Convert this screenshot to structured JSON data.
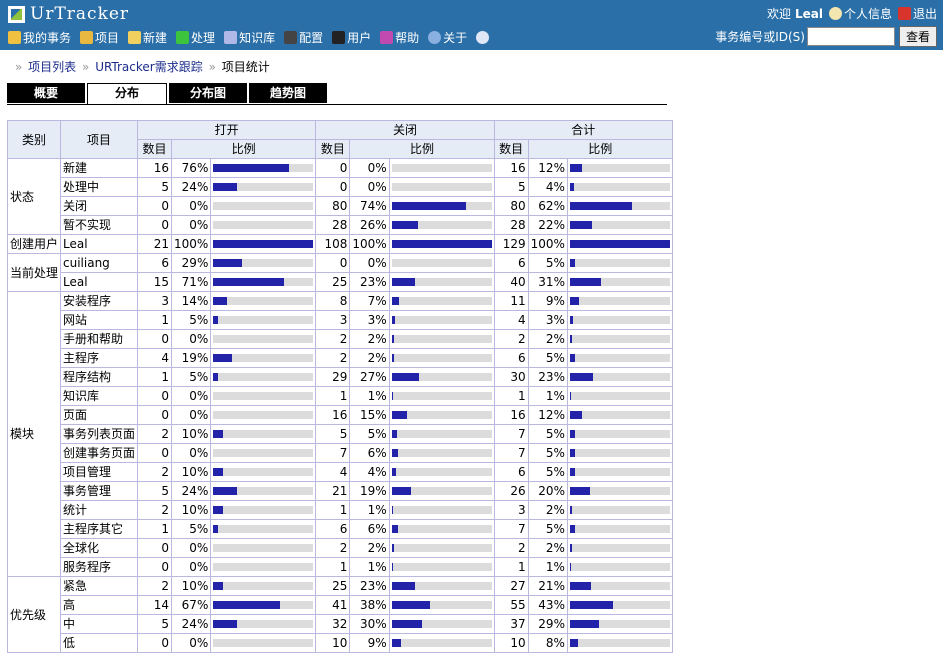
{
  "app": {
    "title": "UrTracker"
  },
  "user": {
    "welcome": "欢迎",
    "name": "Leal",
    "profile": "个人信息",
    "logout": "退出"
  },
  "nav": [
    {
      "label": "我的事务",
      "icon": "home-icon"
    },
    {
      "label": "项目",
      "icon": "project-icon"
    },
    {
      "label": "新建",
      "icon": "new-icon"
    },
    {
      "label": "处理",
      "icon": "check-icon"
    },
    {
      "label": "知识库",
      "icon": "book-icon"
    },
    {
      "label": "配置",
      "icon": "config-icon"
    },
    {
      "label": "用户",
      "icon": "users-icon"
    },
    {
      "label": "帮助",
      "icon": "help-icon"
    },
    {
      "label": "关于",
      "icon": "about-icon"
    },
    {
      "label": "",
      "icon": "info-icon"
    }
  ],
  "search": {
    "label": "事务编号或ID(S)",
    "value": "",
    "button": "查看"
  },
  "breadcrumb": [
    "项目列表",
    "URTracker需求跟踪",
    "项目统计"
  ],
  "tabs": [
    {
      "label": "概要",
      "active": false
    },
    {
      "label": "分布",
      "active": true
    },
    {
      "label": "分布图",
      "active": false
    },
    {
      "label": "趋势图",
      "active": false
    }
  ],
  "table": {
    "headers": {
      "category": "类别",
      "item": "项目",
      "open": "打开",
      "closed": "关闭",
      "total": "合计",
      "count": "数目",
      "ratio": "比例"
    },
    "groups": [
      {
        "category": "状态",
        "rows": [
          {
            "item": "新建",
            "o": 16,
            "op": "76%",
            "c": 0,
            "cp": "0%",
            "t": 16,
            "tp": "12%"
          },
          {
            "item": "处理中",
            "o": 5,
            "op": "24%",
            "c": 0,
            "cp": "0%",
            "t": 5,
            "tp": "4%"
          },
          {
            "item": "关闭",
            "o": 0,
            "op": "0%",
            "c": 80,
            "cp": "74%",
            "t": 80,
            "tp": "62%"
          },
          {
            "item": "暂不实现",
            "o": 0,
            "op": "0%",
            "c": 28,
            "cp": "26%",
            "t": 28,
            "tp": "22%"
          }
        ]
      },
      {
        "category": "创建用户",
        "rows": [
          {
            "item": "Leal",
            "o": 21,
            "op": "100%",
            "c": 108,
            "cp": "100%",
            "t": 129,
            "tp": "100%"
          }
        ]
      },
      {
        "category": "当前处理",
        "rows": [
          {
            "item": "cuiliang",
            "o": 6,
            "op": "29%",
            "c": 0,
            "cp": "0%",
            "t": 6,
            "tp": "5%"
          },
          {
            "item": "Leal",
            "o": 15,
            "op": "71%",
            "c": 25,
            "cp": "23%",
            "t": 40,
            "tp": "31%"
          }
        ]
      },
      {
        "category": "模块",
        "rows": [
          {
            "item": "安装程序",
            "o": 3,
            "op": "14%",
            "c": 8,
            "cp": "7%",
            "t": 11,
            "tp": "9%"
          },
          {
            "item": "网站",
            "o": 1,
            "op": "5%",
            "c": 3,
            "cp": "3%",
            "t": 4,
            "tp": "3%"
          },
          {
            "item": "手册和帮助",
            "o": 0,
            "op": "0%",
            "c": 2,
            "cp": "2%",
            "t": 2,
            "tp": "2%"
          },
          {
            "item": "主程序",
            "o": 4,
            "op": "19%",
            "c": 2,
            "cp": "2%",
            "t": 6,
            "tp": "5%"
          },
          {
            "item": "程序结构",
            "o": 1,
            "op": "5%",
            "c": 29,
            "cp": "27%",
            "t": 30,
            "tp": "23%"
          },
          {
            "item": "知识库",
            "o": 0,
            "op": "0%",
            "c": 1,
            "cp": "1%",
            "t": 1,
            "tp": "1%"
          },
          {
            "item": "页面",
            "o": 0,
            "op": "0%",
            "c": 16,
            "cp": "15%",
            "t": 16,
            "tp": "12%"
          },
          {
            "item": "事务列表页面",
            "o": 2,
            "op": "10%",
            "c": 5,
            "cp": "5%",
            "t": 7,
            "tp": "5%"
          },
          {
            "item": "创建事务页面",
            "o": 0,
            "op": "0%",
            "c": 7,
            "cp": "6%",
            "t": 7,
            "tp": "5%"
          },
          {
            "item": "项目管理",
            "o": 2,
            "op": "10%",
            "c": 4,
            "cp": "4%",
            "t": 6,
            "tp": "5%"
          },
          {
            "item": "事务管理",
            "o": 5,
            "op": "24%",
            "c": 21,
            "cp": "19%",
            "t": 26,
            "tp": "20%"
          },
          {
            "item": "统计",
            "o": 2,
            "op": "10%",
            "c": 1,
            "cp": "1%",
            "t": 3,
            "tp": "2%"
          },
          {
            "item": "主程序其它",
            "o": 1,
            "op": "5%",
            "c": 6,
            "cp": "6%",
            "t": 7,
            "tp": "5%"
          },
          {
            "item": "全球化",
            "o": 0,
            "op": "0%",
            "c": 2,
            "cp": "2%",
            "t": 2,
            "tp": "2%"
          },
          {
            "item": "服务程序",
            "o": 0,
            "op": "0%",
            "c": 1,
            "cp": "1%",
            "t": 1,
            "tp": "1%"
          }
        ]
      },
      {
        "category": "优先级",
        "rows": [
          {
            "item": "紧急",
            "o": 2,
            "op": "10%",
            "c": 25,
            "cp": "23%",
            "t": 27,
            "tp": "21%"
          },
          {
            "item": "高",
            "o": 14,
            "op": "67%",
            "c": 41,
            "cp": "38%",
            "t": 55,
            "tp": "43%"
          },
          {
            "item": "中",
            "o": 5,
            "op": "24%",
            "c": 32,
            "cp": "30%",
            "t": 37,
            "tp": "29%"
          },
          {
            "item": "低",
            "o": 0,
            "op": "0%",
            "c": 10,
            "cp": "9%",
            "t": 10,
            "tp": "8%"
          }
        ]
      }
    ]
  },
  "colors": {
    "header_bg": "#2a6fa8",
    "bar_fill": "#2323aa",
    "bar_track": "#dcdcdc",
    "grid": "#b8b8e0"
  }
}
